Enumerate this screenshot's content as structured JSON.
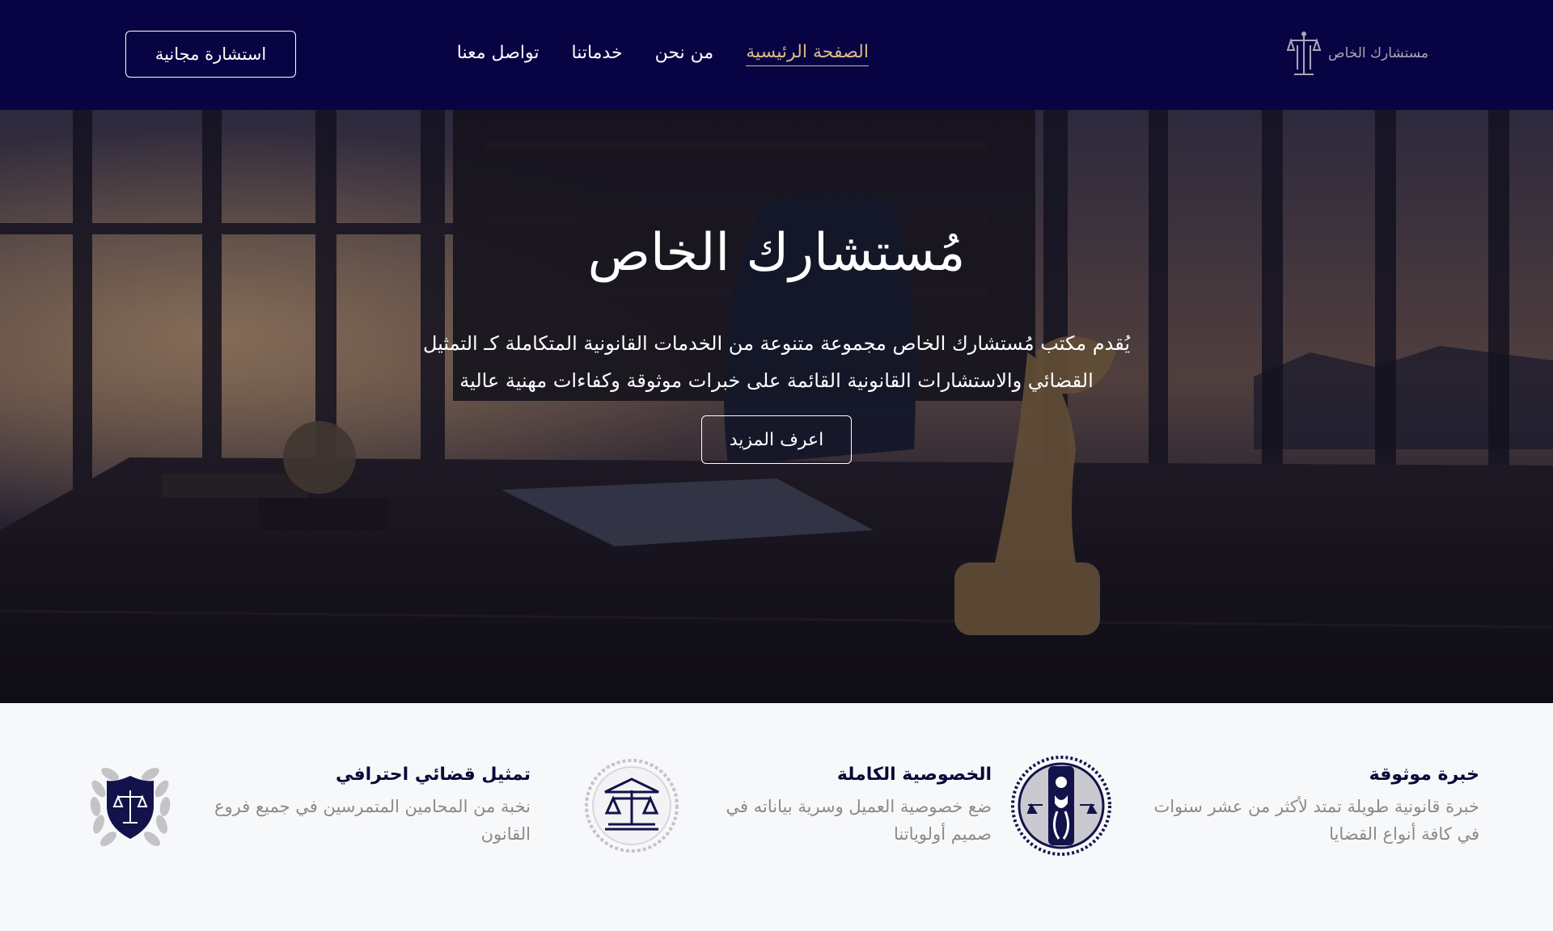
{
  "header": {
    "logo_text": "مستشارك الخاص",
    "logo_icon": "scales-pillar-icon",
    "nav": [
      {
        "label": "الصفحة الرئيسية",
        "active": true
      },
      {
        "label": "من نحن",
        "active": false
      },
      {
        "label": "خدماتنا",
        "active": false
      },
      {
        "label": "تواصل معنا",
        "active": false
      }
    ],
    "cta_label": "استشارة مجانية"
  },
  "hero": {
    "title": "مُستشارك الخاص",
    "description_line1": "يُقدم مكتب مُستشارك الخاص مجموعة متنوعة من الخدمات القانونية المتكاملة كـ التمثيل",
    "description_line2": "القضائي والاستشارات القانونية القائمة على خبرات موثوقة وكفاءات مهنية عالية",
    "button_label": "اعرف المزيد"
  },
  "features": [
    {
      "title": "خبرة موثوقة",
      "line1": "خبرة قانونية طويلة تمتد لأكثر من عشر سنوات",
      "line2": "في كافة أنواع القضايا",
      "icon": "justice-figure-emblem-icon"
    },
    {
      "title": "الخصوصية الكاملة",
      "line1": "ضع خصوصية العميل وسرية بياناته في",
      "line2": "صميم أولوياتنا",
      "icon": "scales-building-emblem-icon"
    },
    {
      "title": "تمثيل قضائي احترافي",
      "line1": "نخبة من المحامين المتمرسين في جميع فروع",
      "line2": "القانون",
      "icon": "shield-scales-laurel-icon"
    }
  ],
  "colors": {
    "navy": "#080443",
    "gold": "#d8b986",
    "text_gray": "#8a8a8a"
  }
}
